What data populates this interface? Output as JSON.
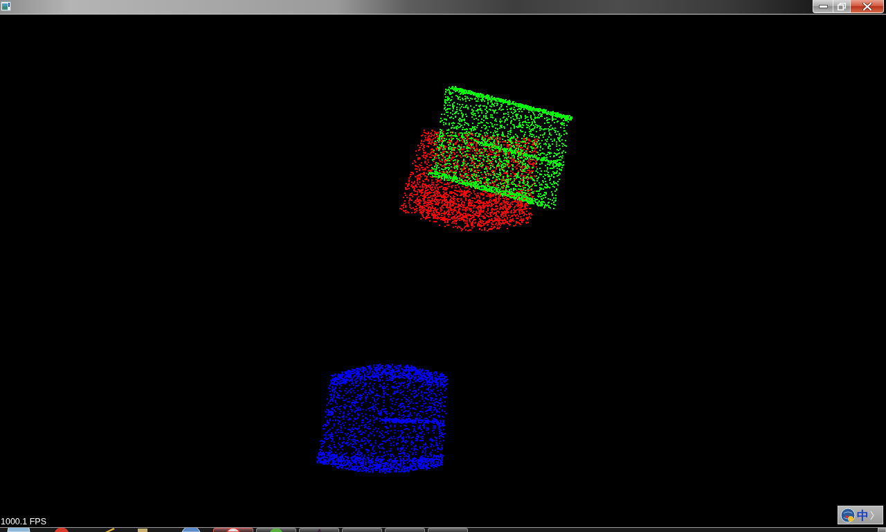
{
  "viewer": {
    "clouds": [
      {
        "color": "#00ff00"
      },
      {
        "color": "#ff0000"
      },
      {
        "color": "#0000ff"
      }
    ],
    "fps": "1000.1 FPS"
  },
  "language_bar": {
    "label": "中"
  }
}
